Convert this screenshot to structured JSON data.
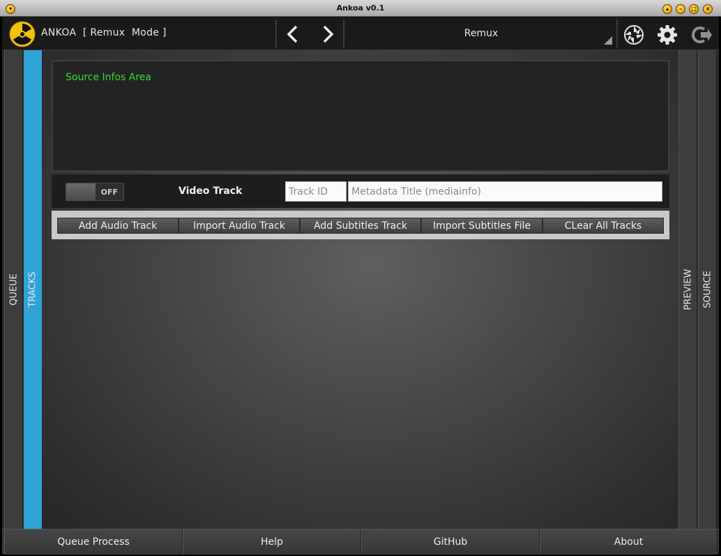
{
  "window": {
    "title": "Ankoa v0.1"
  },
  "toolbar": {
    "app_title": "ANKOA  [ Remux  Mode ]",
    "mode_selected": "Remux"
  },
  "tabs": {
    "left": [
      "QUEUE",
      "TRACKS"
    ],
    "right": [
      "PREVIEW",
      "SOURCE"
    ],
    "active": "TRACKS"
  },
  "source_info": {
    "label": "Source Infos Area"
  },
  "video_track": {
    "toggle_state": "OFF",
    "label": "Video Track",
    "track_id_placeholder": "Track ID",
    "metadata_title_placeholder": "Metadata Title (mediainfo)"
  },
  "track_buttons": [
    "Add Audio Track",
    "Import Audio Track",
    "Add Subtitles Track",
    "Import Subtitles File",
    "CLear All Tracks"
  ],
  "bottom_buttons": [
    "Queue Process",
    "Help",
    "GitHub",
    "About"
  ],
  "colors": {
    "accent_tab": "#2ea3d5",
    "info_text": "#33dd33",
    "window_button": "#f0a500"
  }
}
